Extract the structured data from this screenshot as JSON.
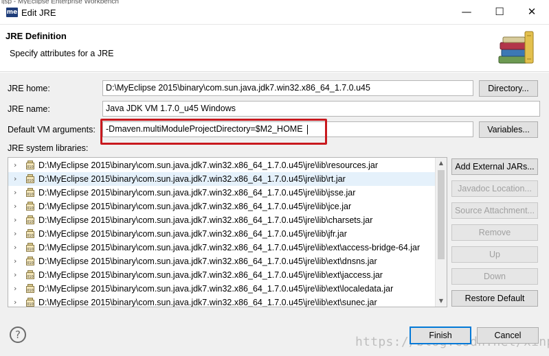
{
  "window": {
    "behind_text": "ijsp - MyEclipse Enterprise Workbench",
    "app_icon_text": "me",
    "title": "Edit JRE",
    "minimize_glyph": "—",
    "maximize_glyph": "☐",
    "close_glyph": "✕"
  },
  "header": {
    "title": "JRE Definition",
    "subtitle": "Specify attributes for a JRE",
    "icon": "books-icon"
  },
  "form": {
    "jre_home_label": "JRE home:",
    "jre_home_value": "D:\\MyEclipse 2015\\binary\\com.sun.java.jdk7.win32.x86_64_1.7.0.u45",
    "directory_button": "Directory...",
    "jre_name_label": "JRE name:",
    "jre_name_value": "Java JDK VM 1.7.0_u45 Windows",
    "vm_args_label": "Default VM arguments:",
    "vm_args_value": "-Dmaven.multiModuleProjectDirectory=$M2_HOME",
    "variables_button": "Variables...",
    "libraries_label": "JRE system libraries:"
  },
  "libraries": [
    {
      "path": "D:\\MyEclipse 2015\\binary\\com.sun.java.jdk7.win32.x86_64_1.7.0.u45\\jre\\lib\\resources.jar",
      "selected": false
    },
    {
      "path": "D:\\MyEclipse 2015\\binary\\com.sun.java.jdk7.win32.x86_64_1.7.0.u45\\jre\\lib\\rt.jar",
      "selected": true
    },
    {
      "path": "D:\\MyEclipse 2015\\binary\\com.sun.java.jdk7.win32.x86_64_1.7.0.u45\\jre\\lib\\jsse.jar",
      "selected": false
    },
    {
      "path": "D:\\MyEclipse 2015\\binary\\com.sun.java.jdk7.win32.x86_64_1.7.0.u45\\jre\\lib\\jce.jar",
      "selected": false
    },
    {
      "path": "D:\\MyEclipse 2015\\binary\\com.sun.java.jdk7.win32.x86_64_1.7.0.u45\\jre\\lib\\charsets.jar",
      "selected": false
    },
    {
      "path": "D:\\MyEclipse 2015\\binary\\com.sun.java.jdk7.win32.x86_64_1.7.0.u45\\jre\\lib\\jfr.jar",
      "selected": false
    },
    {
      "path": "D:\\MyEclipse 2015\\binary\\com.sun.java.jdk7.win32.x86_64_1.7.0.u45\\jre\\lib\\ext\\access-bridge-64.jar",
      "selected": false
    },
    {
      "path": "D:\\MyEclipse 2015\\binary\\com.sun.java.jdk7.win32.x86_64_1.7.0.u45\\jre\\lib\\ext\\dnsns.jar",
      "selected": false
    },
    {
      "path": "D:\\MyEclipse 2015\\binary\\com.sun.java.jdk7.win32.x86_64_1.7.0.u45\\jre\\lib\\ext\\jaccess.jar",
      "selected": false
    },
    {
      "path": "D:\\MyEclipse 2015\\binary\\com.sun.java.jdk7.win32.x86_64_1.7.0.u45\\jre\\lib\\ext\\localedata.jar",
      "selected": false
    },
    {
      "path": "D:\\MyEclipse 2015\\binary\\com.sun.java.jdk7.win32.x86_64_1.7.0.u45\\jre\\lib\\ext\\sunec.jar",
      "selected": false
    }
  ],
  "side_buttons": [
    {
      "label": "Add External JARs...",
      "enabled": true
    },
    {
      "label": "Javadoc Location...",
      "enabled": false
    },
    {
      "label": "Source Attachment...",
      "enabled": false
    },
    {
      "label": "Remove",
      "enabled": false
    },
    {
      "label": "Up",
      "enabled": false
    },
    {
      "label": "Down",
      "enabled": false
    },
    {
      "label": "Restore Default",
      "enabled": true
    }
  ],
  "footer": {
    "help_glyph": "?",
    "finish_button": "Finish",
    "cancel_button": "Cancel",
    "watermark": "https://blog.csdn.net/xinpz"
  },
  "colors": {
    "highlight_border": "#c8191e",
    "selection_bg": "#e5f1fb",
    "primary_button_border": "#0078d7"
  }
}
